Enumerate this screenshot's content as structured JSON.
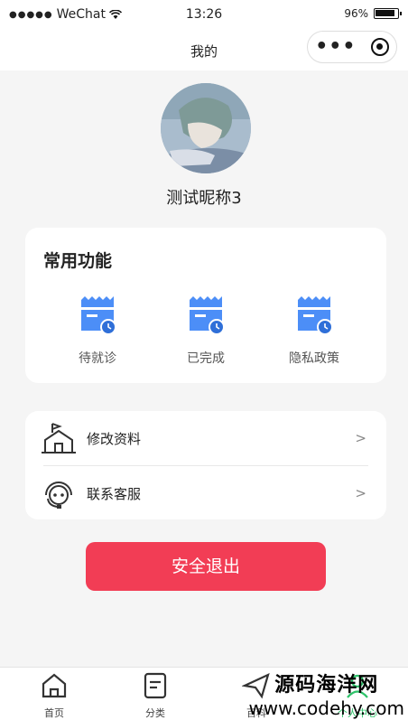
{
  "status_bar": {
    "signal": "●●●●●",
    "carrier": "WeChat",
    "time": "13:26",
    "battery": "96%"
  },
  "nav": {
    "title": "我的",
    "capsule_more": "•••"
  },
  "profile": {
    "nickname": "测试昵称3"
  },
  "functions": {
    "title": "常用功能",
    "items": [
      {
        "label": "待就诊",
        "icon": "calendar-clock-icon"
      },
      {
        "label": "已完成",
        "icon": "calendar-clock-icon"
      },
      {
        "label": "隐私政策",
        "icon": "calendar-clock-icon"
      }
    ],
    "accent": "#4c8ef7"
  },
  "menu": [
    {
      "label": "修改资料",
      "arrow": ">",
      "icon": "building-flag-icon"
    },
    {
      "label": "联系客服",
      "arrow": ">",
      "icon": "headset-icon"
    }
  ],
  "logout": {
    "label": "安全退出",
    "color": "#f23d55"
  },
  "tabbar": [
    {
      "label": "首页",
      "icon": "home-icon"
    },
    {
      "label": "分类",
      "icon": "list-icon"
    },
    {
      "label": "百科",
      "icon": "send-icon"
    },
    {
      "label": "个人中心",
      "icon": "user-icon"
    }
  ],
  "watermark": {
    "line1": "源码海洋网",
    "line2": "www.codehy.com"
  }
}
